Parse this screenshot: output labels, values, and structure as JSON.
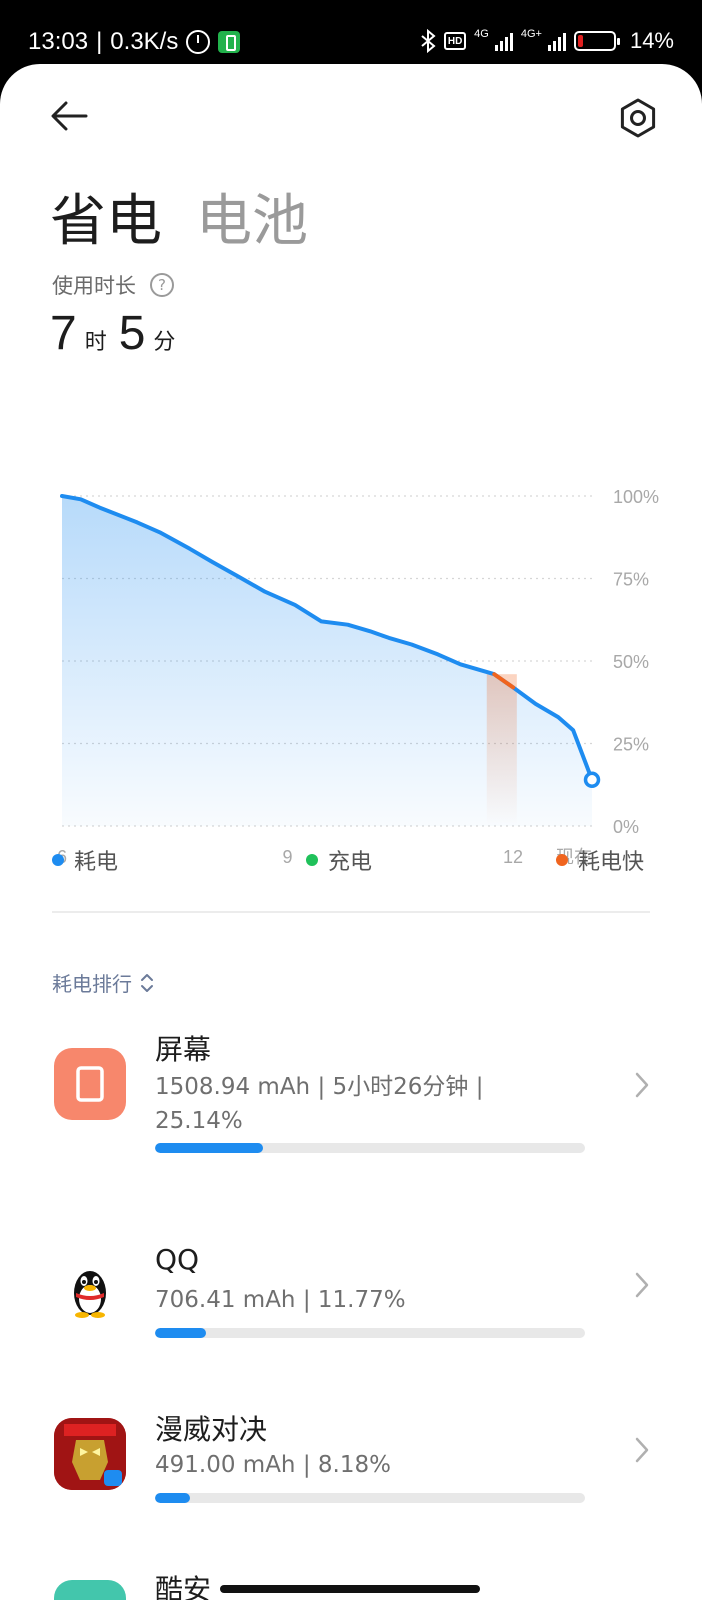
{
  "status_bar": {
    "time": "13:03",
    "net_speed": "0.3K/s",
    "sim1_label": "4G",
    "sim2_label": "4G+",
    "battery_pct": "14%"
  },
  "header": {
    "tab_power_saving": "省电",
    "tab_battery": "电池"
  },
  "usage": {
    "label": "使用时长",
    "hours": "7",
    "hours_unit": "时",
    "minutes": "5",
    "minutes_unit": "分"
  },
  "chart_data": {
    "type": "line",
    "x_tick_labels": [
      "6",
      "9",
      "12",
      "现在"
    ],
    "y_tick_labels": [
      "100%",
      "75%",
      "50%",
      "25%",
      "0%"
    ],
    "ylim": [
      0,
      100
    ],
    "x_unit": "hour",
    "xlim": [
      6,
      13.05
    ],
    "series": [
      {
        "name": "耗电",
        "color": "#1e8cf0",
        "x": [
          6.0,
          6.25,
          6.5,
          7.0,
          7.3,
          7.7,
          8.0,
          8.35,
          8.7,
          9.1,
          9.45,
          9.8,
          10.1,
          10.35,
          10.65,
          11.0,
          11.3,
          11.75,
          12.0,
          12.3,
          12.6,
          12.8,
          13.05
        ],
        "y": [
          100,
          99,
          96.5,
          92,
          89,
          84,
          80,
          75.5,
          71,
          67,
          62,
          61,
          59,
          57,
          55,
          52,
          49,
          46,
          42,
          37,
          33,
          29,
          14
        ]
      }
    ],
    "fast_drain_segment": {
      "name": "耗电快",
      "color": "#f0641e",
      "x_start": 11.65,
      "x_end": 12.05
    },
    "legend": [
      {
        "label": "耗电",
        "color": "#1e8cf0"
      },
      {
        "label": "充电",
        "color": "#1fc15a"
      },
      {
        "label": "耗电快",
        "color": "#f0641e"
      }
    ],
    "grid": true,
    "legend_position": "bottom"
  },
  "ranking": {
    "header": "耗电排行",
    "items": [
      {
        "name": "屏幕",
        "detail": "1508.94 mAh | 5小时26分钟 | 25.14%",
        "percent": 25.14,
        "icon": "screen-icon"
      },
      {
        "name": "QQ",
        "detail": "706.41 mAh | 11.77%",
        "percent": 11.77,
        "icon": "qq-penguin-icon"
      },
      {
        "name": "漫威对决",
        "detail": "491.00 mAh | 8.18%",
        "percent": 8.18,
        "icon": "marvel-game-icon"
      },
      {
        "name": "酷安",
        "icon": "coolapk-icon"
      }
    ]
  }
}
